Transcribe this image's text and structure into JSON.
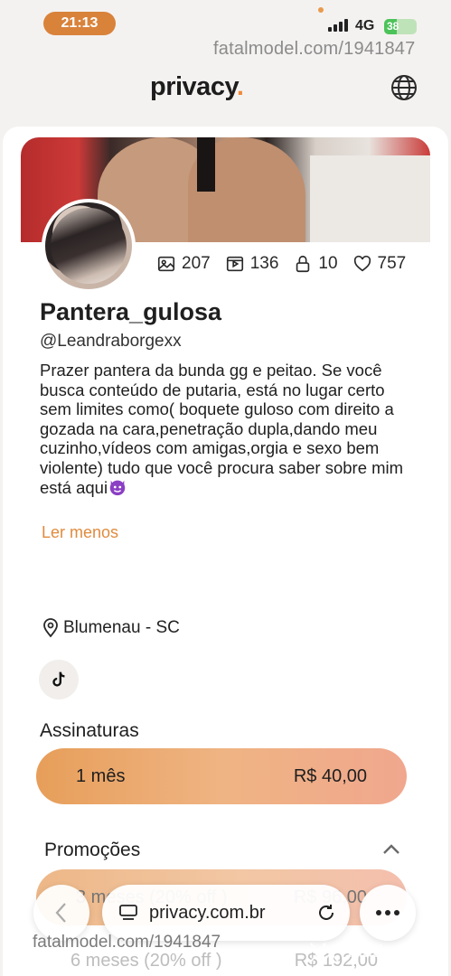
{
  "status_bar": {
    "time": "21:13",
    "network": "4G",
    "battery": "38",
    "battery_level": 0.38
  },
  "watermark": {
    "text": "fatalmodel.com/1941847",
    "logo_text": "fatalmodel"
  },
  "header": {
    "brand": "privacy",
    "brand_dot": "."
  },
  "profile": {
    "stats": {
      "photos": "207",
      "videos": "136",
      "locked": "10",
      "likes": "757"
    },
    "name": "Pantera_gulosa",
    "handle": "@Leandraborgexx",
    "bio": "Prazer pantera da bunda gg e peitao. Se você busca conteúdo de putaria, está no lugar certo sem limites como( boquete guloso com direito a gozada na cara,penetração dupla,dando meu cuzinho,vídeos com amigas,orgia e sexo bem violente) tudo que você procura saber sobre mim está aqui",
    "read_less": "Ler menos",
    "location": "Blumenau - SC"
  },
  "subscriptions": {
    "title": "Assinaturas",
    "plan": {
      "period": "1 mês",
      "price": "R$ 40,00"
    }
  },
  "promotions": {
    "title": "Promoções",
    "items": [
      {
        "period": "3 meses (20% off )",
        "price": "R$ 96,00"
      },
      {
        "period": "6 meses (20% off )",
        "price": "R$ 192,00"
      }
    ]
  },
  "browser": {
    "url": "privacy.com.br"
  },
  "colors": {
    "accent": "#ef8a3b",
    "time_pill": "#d9823a",
    "link": "#e08b3e"
  }
}
